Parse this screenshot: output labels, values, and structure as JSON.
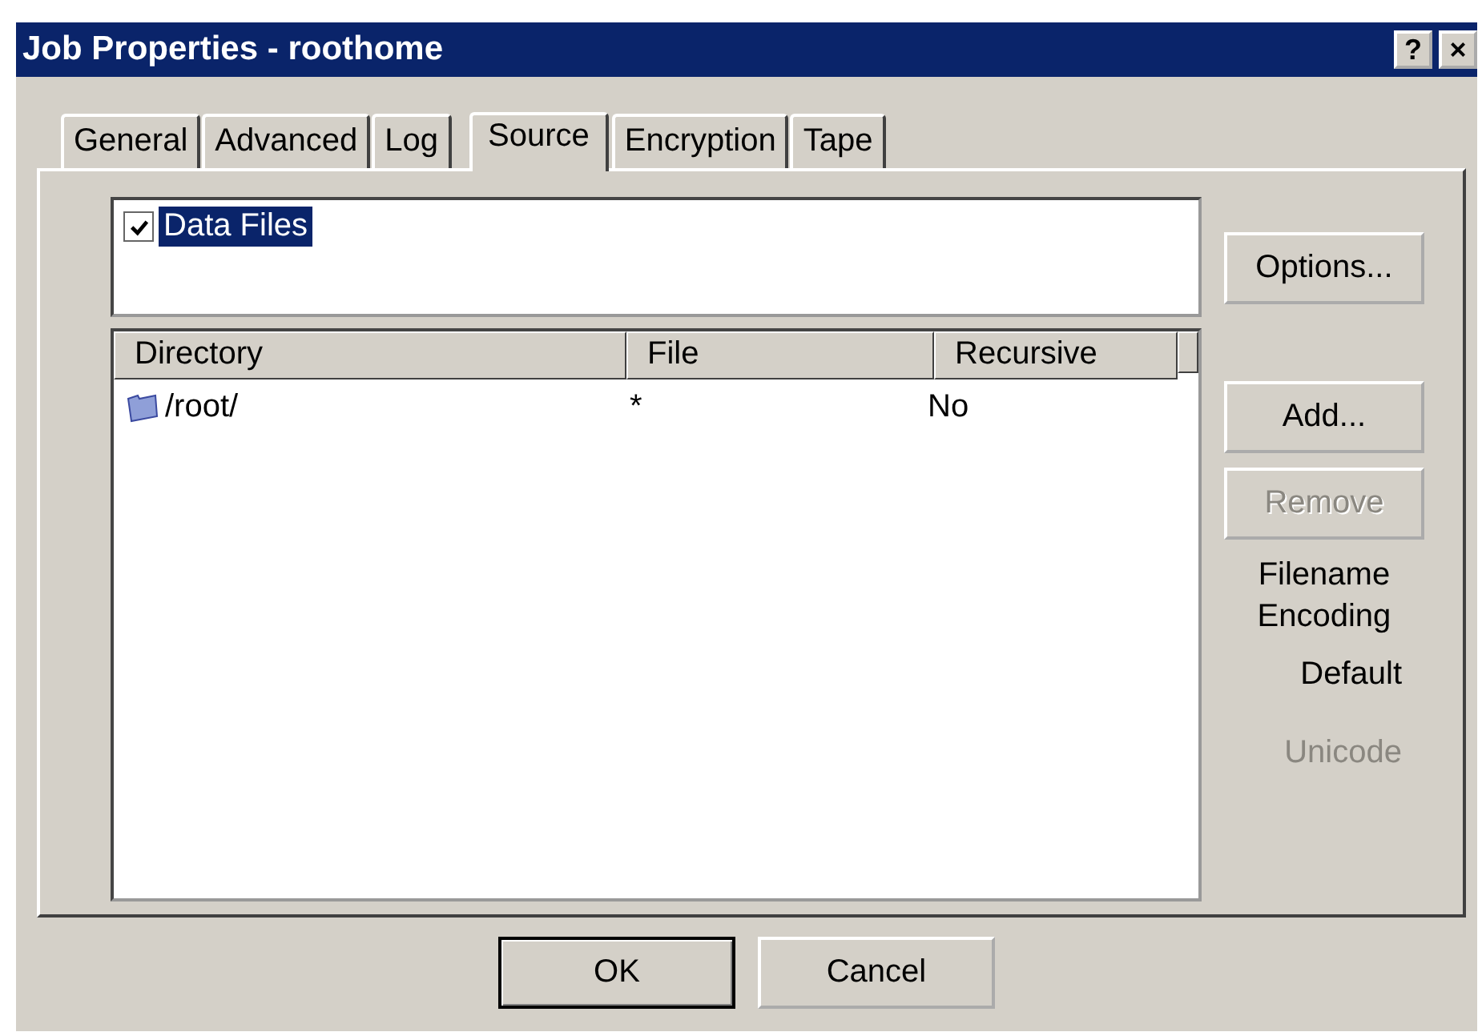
{
  "window": {
    "title": "Job Properties - roothome",
    "title_buttons": [
      "?",
      "×"
    ]
  },
  "tabs": [
    {
      "label": "General",
      "selected": false
    },
    {
      "label": "Advanced",
      "selected": false
    },
    {
      "label": "Log",
      "selected": false
    },
    {
      "label": "Source",
      "selected": true
    },
    {
      "label": "Encryption",
      "selected": false
    },
    {
      "label": "Tape",
      "selected": false
    }
  ],
  "source_list": {
    "items": [
      {
        "label": "Data Files",
        "checked": true,
        "selected": true
      }
    ]
  },
  "table": {
    "columns": [
      "Directory",
      "File",
      "Recursive"
    ],
    "rows": [
      {
        "cells": [
          "/root/",
          "*",
          "No"
        ]
      }
    ]
  },
  "side_buttons": [
    {
      "label": "Options...",
      "disabled": false
    },
    {
      "label": "Add...",
      "disabled": false
    },
    {
      "label": "Remove",
      "disabled": true
    }
  ],
  "encoding": {
    "label": "Filename Encoding",
    "options": [
      {
        "label": "Default",
        "disabled": false
      },
      {
        "label": "Unicode",
        "disabled": true
      }
    ]
  },
  "buttons": [
    {
      "label": "OK",
      "default": true
    },
    {
      "label": "Cancel",
      "default": false
    }
  ]
}
